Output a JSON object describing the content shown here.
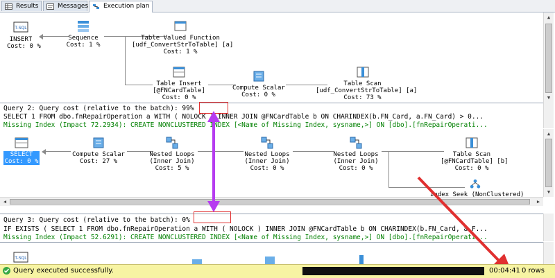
{
  "tabs": [
    {
      "label": "Results",
      "icon": "grid-icon"
    },
    {
      "label": "Messages",
      "icon": "messages-icon"
    },
    {
      "label": "Execution plan",
      "icon": "execution-plan-icon"
    }
  ],
  "plan1": {
    "nodes": {
      "tsql": {
        "label": "T-SQL",
        "name": "INSERT",
        "cost": "Cost: 0 %"
      },
      "sequence": {
        "name": "Sequence",
        "cost": "Cost: 1 %"
      },
      "tvf": {
        "name": "Table Valued Function",
        "sub": "[udf_ConvertStrToTable] [a]",
        "cost": "Cost: 1 %"
      },
      "tableinsert": {
        "name": "Table Insert",
        "sub": "[@FNCardTable]",
        "cost": "Cost: 0 %"
      },
      "computescalar": {
        "name": "Compute Scalar",
        "cost": "Cost: 0 %"
      },
      "tablescan": {
        "name": "Table Scan",
        "sub": "[udf_ConvertStrToTable] [a]",
        "cost": "Cost: 73 %"
      }
    }
  },
  "query2": {
    "header": "Query 2: Query cost (relative to the batch): 99%",
    "sql": "SELECT 1 FROM dbo.fnRepairOperation a WITH ( NOLOCK ) INNER JOIN @FNCardTable b ON CHARINDEX(b.FN_Card, a.FN_Card) > 0...",
    "missing": "Missing Index (Impact 72.2934): CREATE NONCLUSTERED INDEX [<Name of Missing Index, sysname,>] ON [dbo].[fnRepairOperati..."
  },
  "plan2": {
    "nodes": {
      "select": {
        "name": "SELECT",
        "cost": "Cost: 0 %"
      },
      "compute": {
        "name": "Compute Scalar",
        "cost": "Cost: 27 %"
      },
      "nl1": {
        "name": "Nested Loops",
        "sub": "(Inner Join)",
        "cost": "Cost: 5 %"
      },
      "nl2": {
        "name": "Nested Loops",
        "sub": "(Inner Join)",
        "cost": "Cost: 0 %"
      },
      "nl3": {
        "name": "Nested Loops",
        "sub": "(Inner Join)",
        "cost": "Cost: 0 %"
      },
      "tablescan": {
        "name": "Table Scan",
        "sub": "[@FNCardTable] [b]",
        "cost": "Cost: 0 %"
      },
      "indexseek": {
        "name": "Index Seek (NonClustered)"
      }
    }
  },
  "query3": {
    "header": "Query 3: Query cost (relative to the batch): 0%",
    "sql": "IF EXISTS ( SELECT 1 FROM dbo.fnRepairOperation a WITH ( NOLOCK ) INNER JOIN @FNCardTable b ON CHARINDEX(b.FN_Card, a.F...",
    "missing": "Missing Index (Impact 52.6291): CREATE NONCLUSTERED INDEX [<Name of Missing Index, sysname,>] ON [dbo].[fnRepairOperati..."
  },
  "plan3": {
    "nodes": {
      "tsql": {
        "label": "T-SQL"
      }
    }
  },
  "status": {
    "message": "Query executed successfully.",
    "elapsed": "00:04:41",
    "rows": "0 rows"
  },
  "colors": {
    "annotation_red": "#e03030",
    "annotation_purple": "#b63cf0",
    "status_bg": "#f7f4a3",
    "selected": "#3399ff"
  }
}
